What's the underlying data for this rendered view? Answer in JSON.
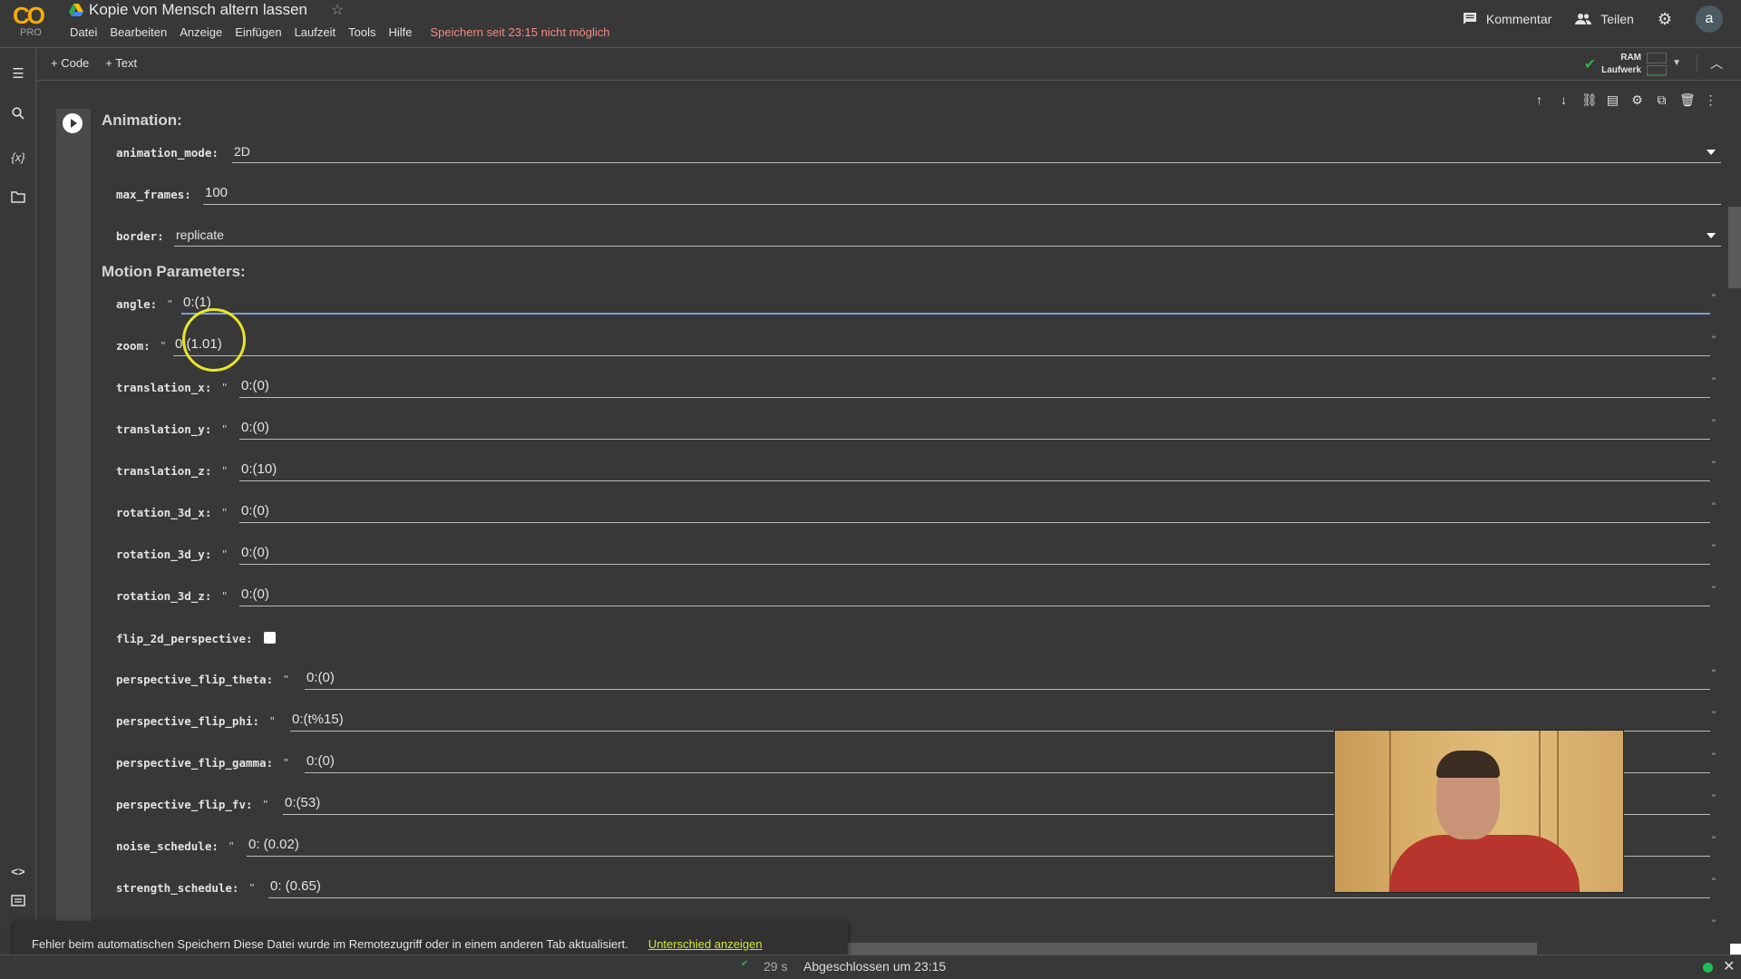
{
  "app": {
    "logo_text": "CO",
    "logo_badge": "PRO",
    "title": "Kopie von Mensch altern lassen"
  },
  "menu": {
    "items": [
      "Datei",
      "Bearbeiten",
      "Anzeige",
      "Einfügen",
      "Laufzeit",
      "Tools",
      "Hilfe"
    ],
    "warning": "Speichern seit 23:15 nicht möglich"
  },
  "header_right": {
    "comment_label": "Kommentar",
    "share_label": "Teilen",
    "avatar_letter": "a"
  },
  "toolbar": {
    "add_code": "+ Code",
    "add_text": "+ Text",
    "ram_label": "RAM",
    "disk_label": "Laufwerk"
  },
  "colors": {
    "warning": "#f28b82",
    "link": "#d6e53a",
    "connected": "#1fbf55",
    "focus": "#7aa1d2"
  },
  "cell": {
    "section_animation": "Animation:",
    "section_motion": "Motion Parameters:",
    "fields": {
      "animation_mode": {
        "label": "animation_mode:",
        "value": "2D"
      },
      "max_frames": {
        "label": "max_frames:",
        "value": "100"
      },
      "border": {
        "label": "border:",
        "value": "replicate"
      },
      "angle": {
        "label": "angle:",
        "value": "0:(1)"
      },
      "zoom": {
        "label": "zoom:",
        "value": "0:(1.01)"
      },
      "translation_x": {
        "label": "translation_x:",
        "value": "0:(0)"
      },
      "translation_y": {
        "label": "translation_y:",
        "value": "0:(0)"
      },
      "translation_z": {
        "label": "translation_z:",
        "value": "0:(10)"
      },
      "rotation_3d_x": {
        "label": "rotation_3d_x:",
        "value": "0:(0)"
      },
      "rotation_3d_y": {
        "label": "rotation_3d_y:",
        "value": "0:(0)"
      },
      "rotation_3d_z": {
        "label": "rotation_3d_z:",
        "value": "0:(0)"
      },
      "flip_2d_perspective": {
        "label": "flip_2d_perspective:",
        "checked": false
      },
      "perspective_flip_theta": {
        "label": "perspective_flip_theta:",
        "value": "0:(0)"
      },
      "perspective_flip_phi": {
        "label": "perspective_flip_phi:",
        "value": "0:(t%15)"
      },
      "perspective_flip_gamma": {
        "label": "perspective_flip_gamma:",
        "value": "0:(0)"
      },
      "perspective_flip_fv": {
        "label": "perspective_flip_fv:",
        "value": "0:(53)"
      },
      "noise_schedule": {
        "label": "noise_schedule:",
        "value": "0: (0.02)"
      },
      "strength_schedule": {
        "label": "strength_schedule:",
        "value": "0: (0.65)"
      }
    },
    "quote": "\""
  },
  "toast": {
    "message": "Fehler beim automatischen Speichern Diese Datei wurde im Remotezugriff oder in einem anderen Tab aktualisiert.",
    "link": "Unterschied anzeigen"
  },
  "status": {
    "elapsed": "29 s",
    "text": "Abgeschlossen um 23:15"
  }
}
